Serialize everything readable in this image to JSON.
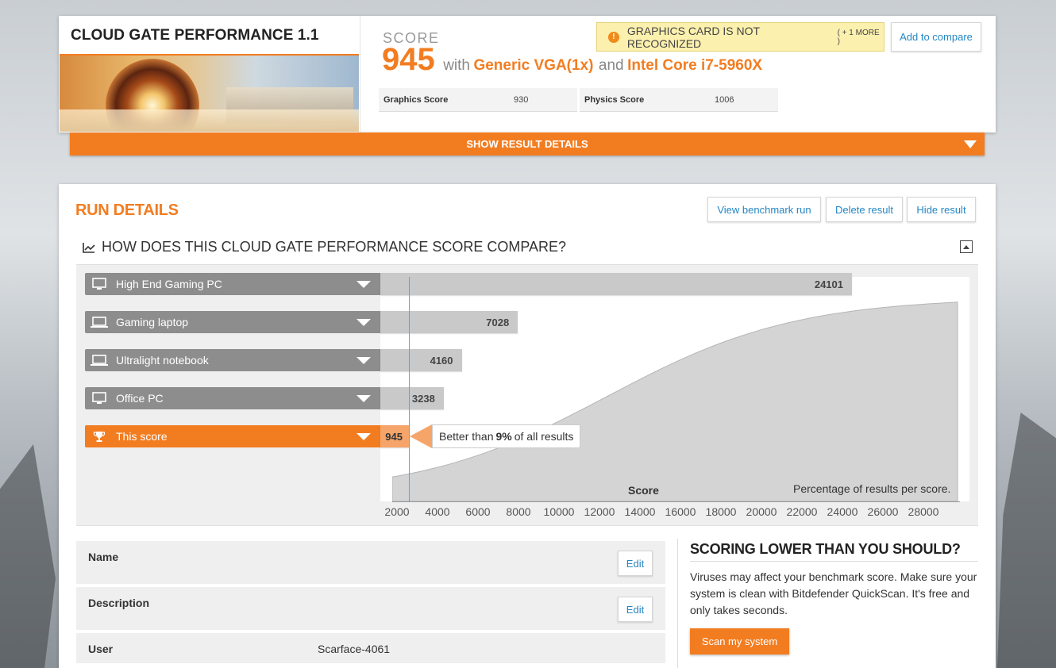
{
  "benchmark": {
    "title": "CLOUD GATE PERFORMANCE 1.1",
    "score_label": "SCORE",
    "score_value": "945",
    "with_text": "with",
    "gpu": "Generic VGA(1x)",
    "and_text": "and",
    "cpu": "Intel Core i7-5960X",
    "subscores": [
      {
        "label": "Graphics Score",
        "value": "930"
      },
      {
        "label": "Physics Score",
        "value": "1006"
      }
    ],
    "warning": {
      "text": "GRAPHICS CARD IS NOT RECOGNIZED",
      "more": "( + 1 MORE )",
      "icon": "!"
    },
    "add_compare": "Add to compare",
    "show_details": "SHOW RESULT DETAILS"
  },
  "run_details": {
    "title": "RUN DETAILS",
    "buttons": {
      "view": "View benchmark run",
      "delete": "Delete result",
      "hide": "Hide result"
    },
    "compare_heading": "HOW DOES THIS CLOUD GATE PERFORMANCE SCORE COMPARE?"
  },
  "chart_data": {
    "type": "bar",
    "categories": [
      "High End Gaming PC",
      "Gaming laptop",
      "Ultralight notebook",
      "Office PC",
      "This score"
    ],
    "values": [
      24101,
      7028,
      4160,
      3238,
      945
    ],
    "value_labels": [
      "24101",
      "7028",
      "4160",
      "3238",
      "945"
    ],
    "highlight": "This score",
    "callout": {
      "prefix": "Better than",
      "percent": "9%",
      "suffix": "of all results"
    },
    "xlabel": "Score",
    "distribution_label": "Percentage of results per score.",
    "x_ticks": [
      "2000",
      "4000",
      "6000",
      "8000",
      "10000",
      "12000",
      "14000",
      "16000",
      "18000",
      "20000",
      "22000",
      "24000",
      "26000",
      "28000"
    ],
    "colors": {
      "bar": "#c9c9c9",
      "highlight": "#f27d21",
      "highlight_bar": "#f6a56a",
      "curve_fill": "#d4d4d4"
    }
  },
  "info": [
    {
      "label": "Name",
      "value": "",
      "edit": "Edit"
    },
    {
      "label": "Description",
      "value": "",
      "edit": "Edit"
    },
    {
      "label": "User",
      "value": "Scarface-4061",
      "edit": ""
    }
  ],
  "promo": {
    "title": "SCORING LOWER THAN YOU SHOULD?",
    "text": "Viruses may affect your benchmark score. Make sure your system is clean with Bitdefender QuickScan. It's free and only takes seconds.",
    "button": "Scan my system"
  },
  "colors": {
    "accent": "#f27d21",
    "link": "#2586c4",
    "warning_bg": "#fcf0ae"
  }
}
